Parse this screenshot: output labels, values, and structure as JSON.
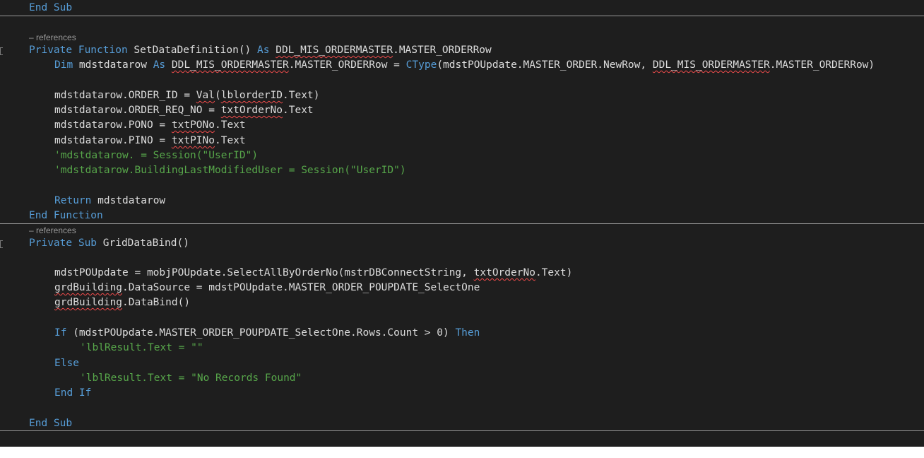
{
  "code": {
    "l_endsub_top": [
      "End Sub"
    ],
    "ref_label_1": "– references",
    "f1_sig": [
      "Private Function",
      " SetDataDefinition() ",
      "As",
      " ",
      "DDL_MIS_ORDERMASTER",
      ".MASTER_ORDERRow"
    ],
    "f1_dim": [
      "Dim",
      " mdstdatarow ",
      "As",
      " ",
      "DDL_MIS_ORDERMASTER",
      ".MASTER_ORDERRow = ",
      "CType",
      "(mdstPOUpdate.MASTER_ORDER.NewRow, ",
      "DDL_MIS_ORDERMASTER",
      ".MASTER_ORDERRow)"
    ],
    "f1_a1": [
      "mdstdatarow.ORDER_ID = ",
      "Val",
      "(",
      "lblorderID",
      ".Text)"
    ],
    "f1_a2": [
      "mdstdatarow.ORDER_REQ_NO = ",
      "txtOrderNo",
      ".Text"
    ],
    "f1_a3": [
      "mdstdatarow.PONO = ",
      "txtPONo",
      ".Text"
    ],
    "f1_a4": [
      "mdstdatarow.PINO = ",
      "txtPINo",
      ".Text"
    ],
    "f1_c1": "'mdstdatarow. = Session(\"UserID\")",
    "f1_c2": "'mdstdatarow.BuildingLastModifiedUser = Session(\"UserID\")",
    "f1_ret": [
      "Return",
      " mdstdatarow"
    ],
    "f1_end": "End Function",
    "ref_label_2": "– references",
    "f2_sig": [
      "Private Sub",
      " GridDataBind()"
    ],
    "f2_a1": [
      "mdstPOUpdate = mobjPOUpdate.SelectAllByOrderNo(mstrDBConnectString, ",
      "txtOrderNo",
      ".Text)"
    ],
    "f2_a2": [
      "grdBuilding",
      ".DataSource = mdstPOUpdate.MASTER_ORDER_POUPDATE_SelectOne"
    ],
    "f2_a3": [
      "grdBuilding",
      ".DataBind()"
    ],
    "f2_if": [
      "If",
      " (mdstPOUpdate.MASTER_ORDER_POUPDATE_SelectOne.Rows.Count > 0) ",
      "Then"
    ],
    "f2_c1": "'lblResult.Text = \"\"",
    "f2_else": "Else",
    "f2_c2": "'lblResult.Text = \"No Records Found\"",
    "f2_endif": "End If",
    "f2_end": "End Sub"
  },
  "colors": {
    "background": "#1e1e1e",
    "keyword": "#569cd6",
    "comment": "#57a64a",
    "text": "#dcdcdc",
    "squiggle": "#f14c4c",
    "codelens": "#999999"
  }
}
